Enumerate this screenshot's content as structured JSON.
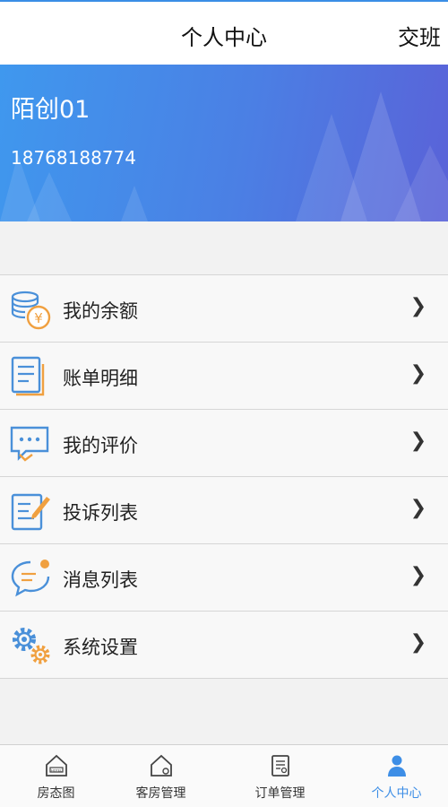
{
  "header": {
    "title": "个人中心",
    "action": "交班"
  },
  "profile": {
    "name": "陌创01",
    "phone": "18768188774"
  },
  "menu": [
    {
      "label": "我的余额",
      "icon": "coins-yen-icon"
    },
    {
      "label": "账单明细",
      "icon": "bill-document-icon"
    },
    {
      "label": "我的评价",
      "icon": "comment-bubble-icon"
    },
    {
      "label": "投诉列表",
      "icon": "complaint-edit-icon"
    },
    {
      "label": "消息列表",
      "icon": "message-bubble-icon"
    },
    {
      "label": "系统设置",
      "icon": "settings-gears-icon"
    }
  ],
  "tabs": [
    {
      "label": "房态图",
      "icon": "hotel-house-icon"
    },
    {
      "label": "客房管理",
      "icon": "room-house-icon"
    },
    {
      "label": "订单管理",
      "icon": "order-document-icon"
    },
    {
      "label": "个人中心",
      "icon": "person-icon",
      "active": true
    }
  ],
  "colors": {
    "accent": "#3d8ee6",
    "hero_start": "#3f98ee",
    "hero_end": "#5a62d8",
    "icon_blue": "#4a90d9",
    "icon_orange": "#f0a040"
  }
}
